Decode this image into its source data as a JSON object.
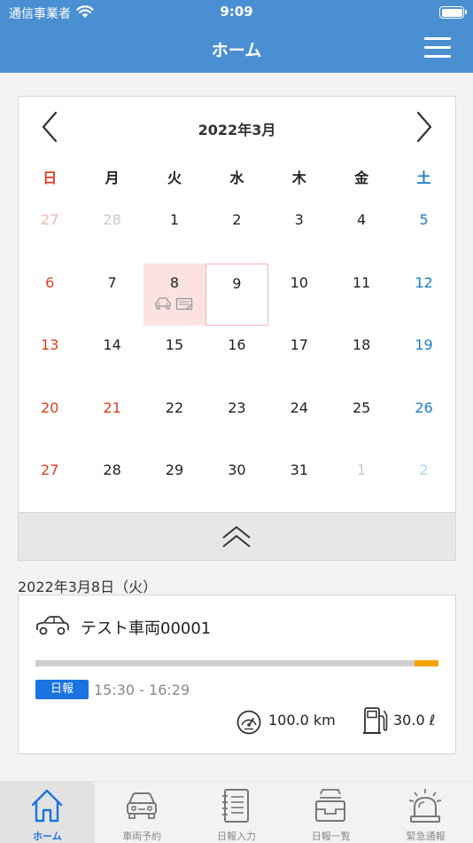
{
  "status_bar": {
    "carrier": "通信事業者",
    "time": "9:09"
  },
  "nav": {
    "title": "ホーム",
    "menu_icon": "hamburger-menu-icon"
  },
  "calendar": {
    "month_label": "2022年3月",
    "weekdays": [
      "日",
      "月",
      "火",
      "水",
      "木",
      "金",
      "土"
    ],
    "weeks": [
      [
        {
          "d": "27",
          "o": true
        },
        {
          "d": "28",
          "o": true
        },
        {
          "d": "1"
        },
        {
          "d": "2"
        },
        {
          "d": "3"
        },
        {
          "d": "4"
        },
        {
          "d": "5"
        }
      ],
      [
        {
          "d": "6"
        },
        {
          "d": "7"
        },
        {
          "d": "8",
          "sel": true,
          "marks": true
        },
        {
          "d": "9",
          "today": true
        },
        {
          "d": "10"
        },
        {
          "d": "11"
        },
        {
          "d": "12"
        }
      ],
      [
        {
          "d": "13"
        },
        {
          "d": "14"
        },
        {
          "d": "15"
        },
        {
          "d": "16"
        },
        {
          "d": "17"
        },
        {
          "d": "18"
        },
        {
          "d": "19"
        }
      ],
      [
        {
          "d": "20"
        },
        {
          "d": "21",
          "hol": true
        },
        {
          "d": "22"
        },
        {
          "d": "23"
        },
        {
          "d": "24"
        },
        {
          "d": "25"
        },
        {
          "d": "26"
        }
      ],
      [
        {
          "d": "27"
        },
        {
          "d": "28"
        },
        {
          "d": "29"
        },
        {
          "d": "30"
        },
        {
          "d": "31"
        },
        {
          "d": "1",
          "o": true
        },
        {
          "d": "2",
          "o": true
        }
      ]
    ]
  },
  "selected_date": "2022年3月8日（火）",
  "record": {
    "vehicle": "テスト車両00001",
    "tag": "日報",
    "time_range": "15:30 - 16:29",
    "usage_fraction_start": 0.94,
    "distance": "100.0 km",
    "fuel": "30.0 ℓ"
  },
  "tabs": [
    {
      "label": "ホーム",
      "icon": "home-icon",
      "active": true
    },
    {
      "label": "車両予約",
      "icon": "car-icon"
    },
    {
      "label": "日報入力",
      "icon": "notebook-icon"
    },
    {
      "label": "日報一覧",
      "icon": "file-tray-icon"
    },
    {
      "label": "緊急通報",
      "icon": "siren-icon"
    }
  ],
  "colors": {
    "accent": "#4a8fd2",
    "sunday": "#e03c21",
    "saturday": "#1b7fc4",
    "selected_day": "#fde2e2",
    "usage": "#f4a300",
    "tag": "#1a73e0"
  }
}
